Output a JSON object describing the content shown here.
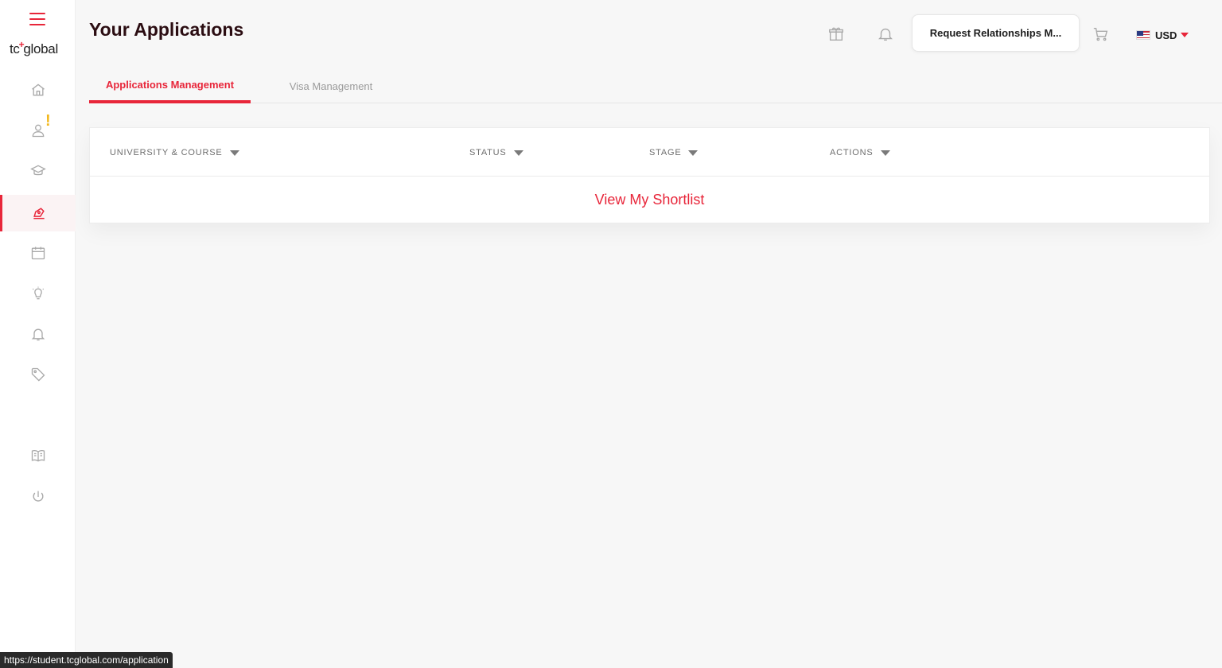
{
  "sidebar": {
    "logo_text": "tc+global",
    "items": [
      {
        "name": "home",
        "icon": "home-icon"
      },
      {
        "name": "profile",
        "icon": "user-icon",
        "alert": "!"
      },
      {
        "name": "courses",
        "icon": "graduation-cap-icon"
      },
      {
        "name": "applications",
        "icon": "pen-icon",
        "active": true
      },
      {
        "name": "calendar",
        "icon": "calendar-icon"
      },
      {
        "name": "ideas",
        "icon": "lightbulb-icon"
      },
      {
        "name": "notifications",
        "icon": "bell-icon"
      },
      {
        "name": "offers",
        "icon": "tag-icon"
      },
      {
        "name": "guides",
        "icon": "book-icon"
      },
      {
        "name": "logout",
        "icon": "power-icon"
      }
    ]
  },
  "header": {
    "title": "Your Applications",
    "request_button": "Request Relationships M...",
    "currency": "USD"
  },
  "tabs": [
    {
      "label": "Applications Management",
      "active": true
    },
    {
      "label": "Visa Management",
      "active": false
    }
  ],
  "table": {
    "columns": [
      "UNIVERSITY & COURSE",
      "STATUS",
      "STAGE",
      "ACTIONS"
    ],
    "empty_link": "View My Shortlist"
  },
  "status_bar": {
    "url": "https://student.tcglobal.com/application"
  },
  "colors": {
    "accent": "#e8263a",
    "alert": "#f2b81e",
    "icon_gray": "#a9a9a9"
  }
}
